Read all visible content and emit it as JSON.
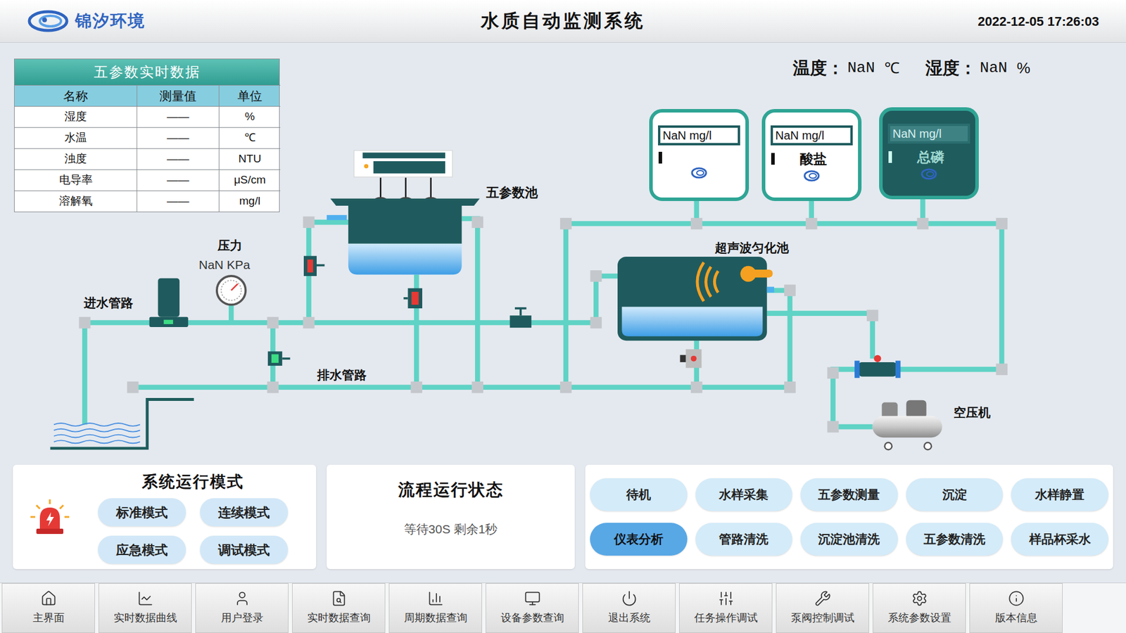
{
  "header": {
    "logo_text": "锦汐环境",
    "title": "水质自动监测系统",
    "datetime": "2022-12-05 17:26:03"
  },
  "environment": [
    {
      "label": "温度：",
      "value": "NaN",
      "unit": "℃"
    },
    {
      "label": "湿度：",
      "value": "NaN",
      "unit": "%"
    }
  ],
  "table": {
    "title": "五参数实时数据",
    "columns": [
      "名称",
      "测量值",
      "单位"
    ],
    "rows": [
      [
        "湿度",
        "——",
        "%"
      ],
      [
        "水温",
        "——",
        "℃"
      ],
      [
        "浊度",
        "——",
        "NTU"
      ],
      [
        "电导率",
        "——",
        "μS/cm"
      ],
      [
        "溶解氧",
        "——",
        "mg/l"
      ]
    ]
  },
  "diagram": {
    "pool_label": "五参数池",
    "pressure_label": "压力",
    "pressure_value": "NaN KPa",
    "inlet_label": "进水管路",
    "drain_label": "排水管路",
    "tank_label": "超声波匀化池",
    "compressor_label": "空压机"
  },
  "analyzers": [
    {
      "value": "NaN mg/l",
      "name": "",
      "dark": false
    },
    {
      "value": "NaN mg/l",
      "name": "酸盐",
      "dark": false
    },
    {
      "value": "NaN mg/l",
      "name": "总磷",
      "dark": true
    }
  ],
  "modes": {
    "title": "系统运行模式",
    "items": [
      {
        "label": "标准模式",
        "selected": false
      },
      {
        "label": "连续模式",
        "selected": false
      },
      {
        "label": "应急模式",
        "selected": false
      },
      {
        "label": "调试模式",
        "selected": false
      }
    ]
  },
  "flow_status": {
    "title": "流程运行状态",
    "text": "等待30S 剩余1秒"
  },
  "steps": [
    {
      "label": "待机",
      "selected": false
    },
    {
      "label": "水样采集",
      "selected": false
    },
    {
      "label": "五参数测量",
      "selected": false
    },
    {
      "label": "沉淀",
      "selected": false
    },
    {
      "label": "水样静置",
      "selected": false
    },
    {
      "label": "仪表分析",
      "selected": true
    },
    {
      "label": "管路清洗",
      "selected": false
    },
    {
      "label": "沉淀池清洗",
      "selected": false
    },
    {
      "label": "五参数清洗",
      "selected": false
    },
    {
      "label": "样品杯采水",
      "selected": false
    }
  ],
  "nav": [
    {
      "label": "主界面"
    },
    {
      "label": "实时数据曲线"
    },
    {
      "label": "用户登录"
    },
    {
      "label": "实时数据查询"
    },
    {
      "label": "周期数据查询"
    },
    {
      "label": "设备参数查询"
    },
    {
      "label": "退出系统"
    },
    {
      "label": "任务操作调试"
    },
    {
      "label": "泵阀控制调试"
    },
    {
      "label": "系统参数设置"
    },
    {
      "label": "版本信息"
    }
  ]
}
